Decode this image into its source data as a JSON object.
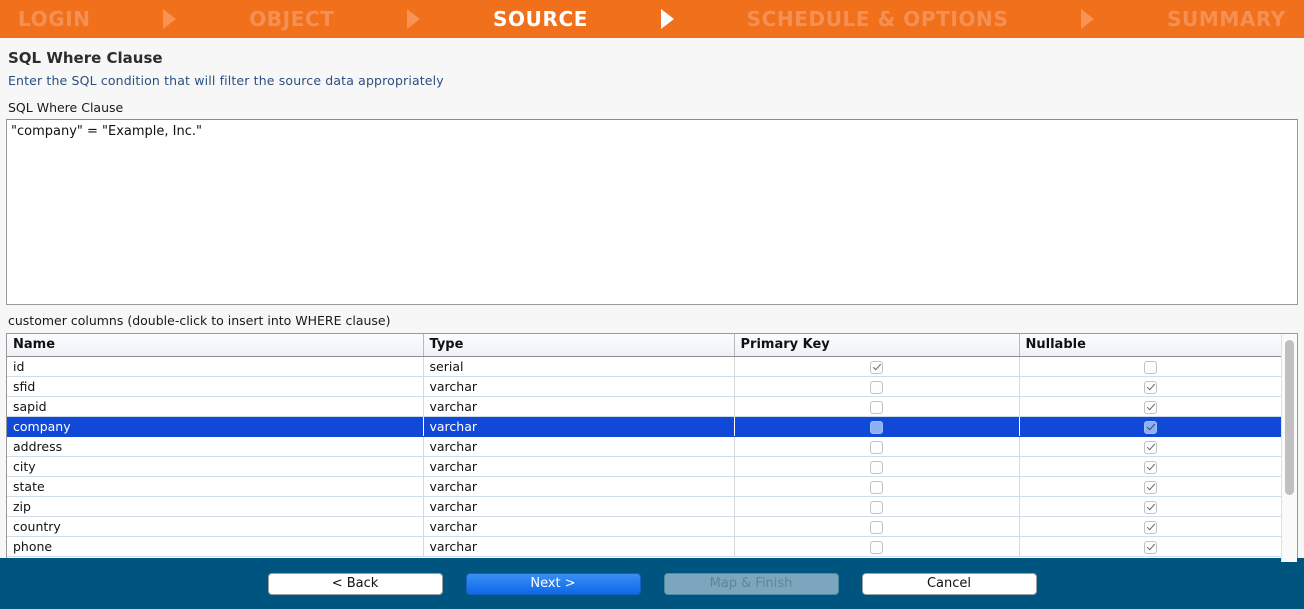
{
  "wizard": {
    "steps": [
      {
        "label": "LOGIN",
        "state": "inactive"
      },
      {
        "label": "OBJECT",
        "state": "inactive"
      },
      {
        "label": "SOURCE",
        "state": "active"
      },
      {
        "label": "SCHEDULE & OPTIONS",
        "state": "inactive"
      },
      {
        "label": "SUMMARY",
        "state": "inactive"
      }
    ],
    "accent_color": "#f1701c",
    "inactive_text_color": "#f59054",
    "active_text_color": "#ffffff"
  },
  "page": {
    "title": "SQL Where Clause",
    "subtitle": "Enter the SQL condition that will filter the source data appropriately",
    "subtitle_color": "#2b4f81"
  },
  "where_clause": {
    "label": "SQL Where Clause",
    "value": "\"company\" = \"Example, Inc.\"",
    "placeholder": ""
  },
  "columns_panel": {
    "caption": "customer columns (double-click to insert into WHERE clause)",
    "headers": [
      "Name",
      "Type",
      "Primary Key",
      "Nullable"
    ],
    "selected_row_index": 3,
    "selection_color": "#1048d7",
    "rows": [
      {
        "name": "id",
        "type": "serial",
        "primary_key": true,
        "nullable": false
      },
      {
        "name": "sfid",
        "type": "varchar",
        "primary_key": false,
        "nullable": true
      },
      {
        "name": "sapid",
        "type": "varchar",
        "primary_key": false,
        "nullable": true
      },
      {
        "name": "company",
        "type": "varchar",
        "primary_key": false,
        "nullable": true
      },
      {
        "name": "address",
        "type": "varchar",
        "primary_key": false,
        "nullable": true
      },
      {
        "name": "city",
        "type": "varchar",
        "primary_key": false,
        "nullable": true
      },
      {
        "name": "state",
        "type": "varchar",
        "primary_key": false,
        "nullable": true
      },
      {
        "name": "zip",
        "type": "varchar",
        "primary_key": false,
        "nullable": true
      },
      {
        "name": "country",
        "type": "varchar",
        "primary_key": false,
        "nullable": true
      },
      {
        "name": "phone",
        "type": "varchar",
        "primary_key": false,
        "nullable": true
      }
    ]
  },
  "footer": {
    "background_color": "#005580",
    "buttons": [
      {
        "label": "< Back",
        "style": "default",
        "enabled": true
      },
      {
        "label": "Next >",
        "style": "primary",
        "enabled": true
      },
      {
        "label": "Map & Finish",
        "style": "disabled",
        "enabled": false
      },
      {
        "label": "Cancel",
        "style": "default",
        "enabled": true
      }
    ]
  }
}
